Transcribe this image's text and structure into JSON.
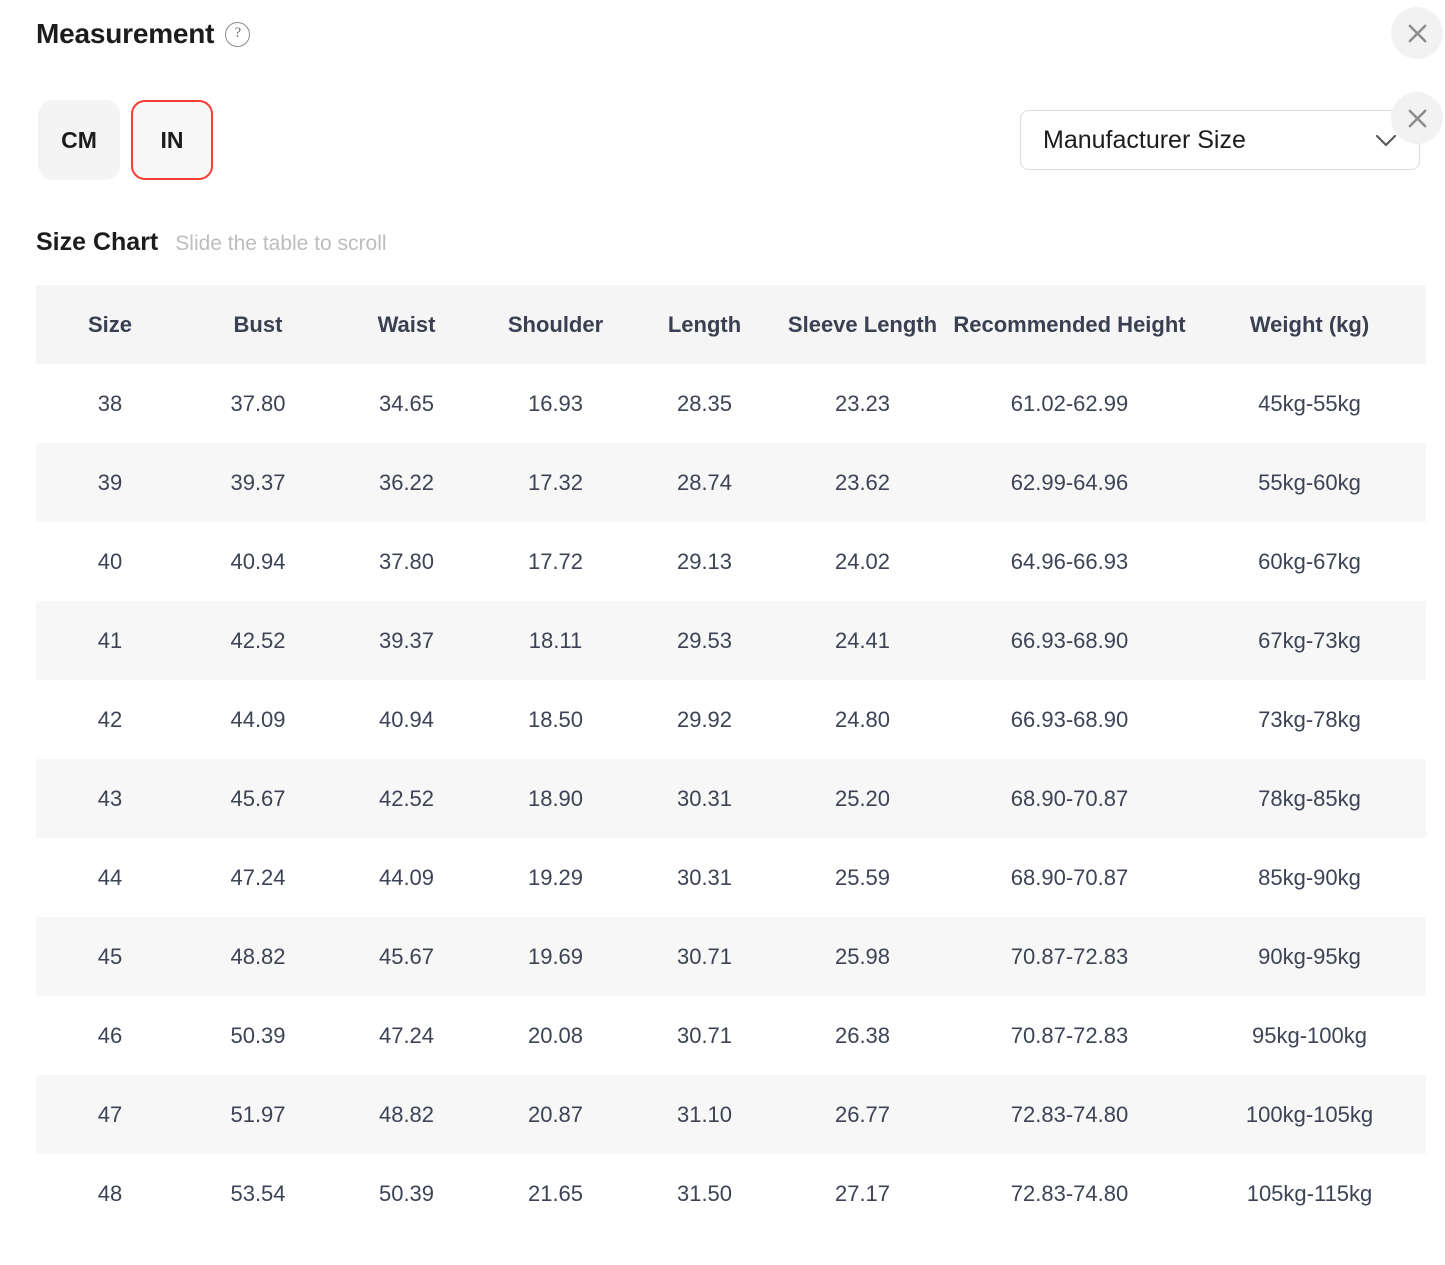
{
  "header": {
    "title": "Measurement",
    "help_icon": "question-circle-icon"
  },
  "unit_toggle": {
    "options": [
      {
        "label": "CM",
        "selected": false
      },
      {
        "label": "IN",
        "selected": true
      }
    ],
    "selected_color": "#fa3a36"
  },
  "size_select": {
    "value": "Manufacturer Size",
    "icon": "chevron-down-icon"
  },
  "close_buttons": [
    {
      "name": "close-icon",
      "label": "×"
    },
    {
      "name": "close-icon",
      "label": "×"
    }
  ],
  "size_chart": {
    "title": "Size Chart",
    "hint": "Slide the table to scroll",
    "columns": [
      "Size",
      "Bust",
      "Waist",
      "Shoulder",
      "Length",
      "Sleeve Length",
      "Recommended Height",
      "Weight (kg)"
    ],
    "rows": [
      [
        "38",
        "37.80",
        "34.65",
        "16.93",
        "28.35",
        "23.23",
        "61.02-62.99",
        "45kg-55kg"
      ],
      [
        "39",
        "39.37",
        "36.22",
        "17.32",
        "28.74",
        "23.62",
        "62.99-64.96",
        "55kg-60kg"
      ],
      [
        "40",
        "40.94",
        "37.80",
        "17.72",
        "29.13",
        "24.02",
        "64.96-66.93",
        "60kg-67kg"
      ],
      [
        "41",
        "42.52",
        "39.37",
        "18.11",
        "29.53",
        "24.41",
        "66.93-68.90",
        "67kg-73kg"
      ],
      [
        "42",
        "44.09",
        "40.94",
        "18.50",
        "29.92",
        "24.80",
        "66.93-68.90",
        "73kg-78kg"
      ],
      [
        "43",
        "45.67",
        "42.52",
        "18.90",
        "30.31",
        "25.20",
        "68.90-70.87",
        "78kg-85kg"
      ],
      [
        "44",
        "47.24",
        "44.09",
        "19.29",
        "30.31",
        "25.59",
        "68.90-70.87",
        "85kg-90kg"
      ],
      [
        "45",
        "48.82",
        "45.67",
        "19.69",
        "30.71",
        "25.98",
        "70.87-72.83",
        "90kg-95kg"
      ],
      [
        "46",
        "50.39",
        "47.24",
        "20.08",
        "30.71",
        "26.38",
        "70.87-72.83",
        "95kg-100kg"
      ],
      [
        "47",
        "51.97",
        "48.82",
        "20.87",
        "31.10",
        "26.77",
        "72.83-74.80",
        "100kg-105kg"
      ],
      [
        "48",
        "53.54",
        "50.39",
        "21.65",
        "31.50",
        "27.17",
        "72.83-74.80",
        "105kg-115kg"
      ]
    ]
  }
}
